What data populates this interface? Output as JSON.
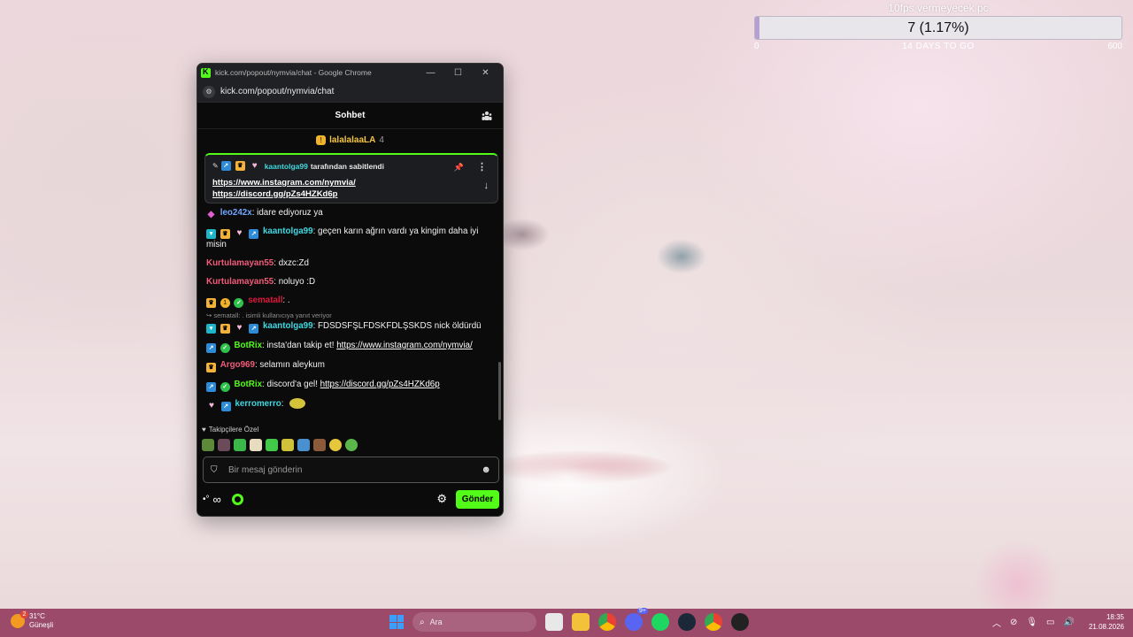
{
  "goal": {
    "title": "10fps vermeyecek pc",
    "value_text": "7 (1.17%)",
    "progress_fraction": 0.0117,
    "min_label": "0",
    "max_label": "600",
    "subtitle": "14 DAYS TO GO"
  },
  "browser": {
    "window_title": "kick.com/popout/nymvia/chat - Google Chrome",
    "url": "kick.com/popout/nymvia/chat",
    "minimize_glyph": "—",
    "maximize_glyph": "☐",
    "close_glyph": "✕"
  },
  "chat": {
    "title": "Sohbet",
    "top_gifter": {
      "name": "lalalalaaLA",
      "count": "4"
    },
    "pinned": {
      "pinned_by_user": "kaantolga99",
      "pinned_by_suffix": "tarafından sabitlendi",
      "links": [
        "https://www.instagram.com/nymvia/",
        "https://discord.gg/pZs4HZKd6p"
      ]
    },
    "messages": [
      {
        "user": "leo242x",
        "user_color": "#6ea8ff",
        "text": "idare ediyoruz ya"
      },
      {
        "user": "kaantolga99",
        "user_color": "#3fd8e0",
        "text": "geçen karın ağrın vardı ya kingim daha iyi misin"
      },
      {
        "user": "Kurtulamayan55",
        "user_color": "#f25b78",
        "text": "dxzc:Zd"
      },
      {
        "user": "Kurtulamayan55",
        "user_color": "#f25b78",
        "text": "noluyo :D"
      },
      {
        "user": "sematall",
        "user_color": "#e0163c",
        "text": "."
      },
      {
        "reply_to": "sematall: . isimli kullanıcıya yanıt veriyor",
        "user": "kaantolga99",
        "user_color": "#3fd8e0",
        "text": "FDSDSFŞLFDSKFDLŞSKDS nick öldürdü"
      },
      {
        "user": "BotRix",
        "user_color": "#53fc18",
        "text": "insta'dan takip et!",
        "link": "https://www.instagram.com/nymvia/"
      },
      {
        "user": "Argo969",
        "user_color": "#f25b78",
        "text": "selamın aleykum"
      },
      {
        "user": "BotRix",
        "user_color": "#53fc18",
        "text": "discord'a gel!",
        "link": "https://discord.gg/pZs4HZKd6p"
      },
      {
        "user": "kerromerro",
        "user_color": "#3fd8e0",
        "text": ""
      }
    ],
    "emote_panel_title": "Takipçilere Özel",
    "input_placeholder": "Bir mesaj gönderin",
    "points": "∞",
    "send_label": "Gönder"
  },
  "taskbar": {
    "weather_temp": "31°C",
    "weather_desc": "Güneşli",
    "weather_badge": "2",
    "search_label": "Ara",
    "discord_badge": "9+",
    "time": "18:35",
    "date": "21.08.2026"
  },
  "colors": {
    "kick_green": "#53fc18",
    "taskbar": "#9c4a6a",
    "goal_fill": "#b79fd3"
  }
}
